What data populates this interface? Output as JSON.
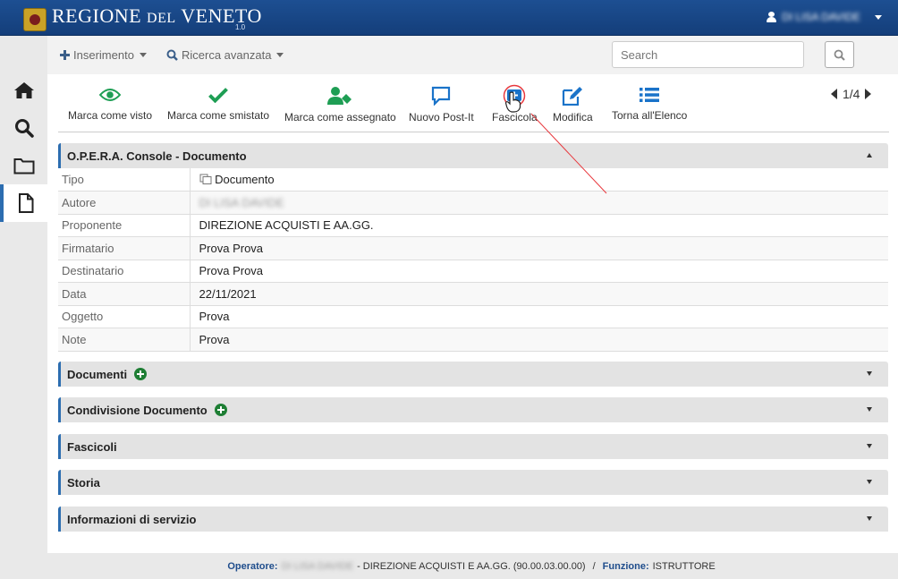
{
  "header": {
    "logo_main": "REGIONE",
    "logo_del": "DEL",
    "logo_end": "VENETO",
    "version": "1.0",
    "user_name": "DI LISA DAVIDE"
  },
  "menubar": {
    "inserimento_label": "Inserimento",
    "ricerca_label": "Ricerca avanzata",
    "search_placeholder": "Search"
  },
  "sidebar": {
    "items": [
      {
        "name": "home",
        "icon": "home-icon"
      },
      {
        "name": "search",
        "icon": "search-icon"
      },
      {
        "name": "folder",
        "icon": "folder-icon"
      },
      {
        "name": "document",
        "icon": "file-icon",
        "active": true
      }
    ]
  },
  "toolbar": {
    "marca_visto": "Marca come visto",
    "marca_smistato": "Marca come smistato",
    "marca_assegnato": "Marca come assegnato",
    "nuovo_postit": "Nuovo Post-It",
    "fascicola": "Fascicola",
    "modifica": "Modifica",
    "torna_elenco": "Torna all'Elenco",
    "pager": "1/4"
  },
  "colors": {
    "header_blue": "#1d4f92",
    "accent_blue": "#2c6db0",
    "icon_green": "#1e9e54",
    "icon_blue": "#1a73c9",
    "plus_green": "#1e7e34",
    "annotation_red": "#e8383d"
  },
  "document_panel": {
    "title": "O.P.E.R.A. Console - Documento",
    "rows": [
      {
        "key": "Tipo",
        "value": "Documento"
      },
      {
        "key": "Autore",
        "value": "DI LISA DAVIDE"
      },
      {
        "key": "Proponente",
        "value": "DIREZIONE ACQUISTI E AA.GG."
      },
      {
        "key": "Firmatario",
        "value": "Prova Prova"
      },
      {
        "key": "Destinatario",
        "value": "Prova Prova"
      },
      {
        "key": "Data",
        "value": "22/11/2021"
      },
      {
        "key": "Oggetto",
        "value": "Prova"
      },
      {
        "key": "Note",
        "value": "Prova"
      }
    ]
  },
  "sections": {
    "documenti": "Documenti",
    "condivisione": "Condivisione Documento",
    "fascicoli": "Fascicoli",
    "storia": "Storia",
    "info_servizio": "Informazioni di servizio"
  },
  "footer": {
    "operatore_label": "Operatore:",
    "operatore_value": "DI LISA DAVIDE",
    "direzione": "- DIREZIONE ACQUISTI E AA.GG. (90.00.03.00.00)",
    "separator": "/",
    "funzione_label": "Funzione:",
    "funzione_value": "ISTRUTTORE"
  }
}
